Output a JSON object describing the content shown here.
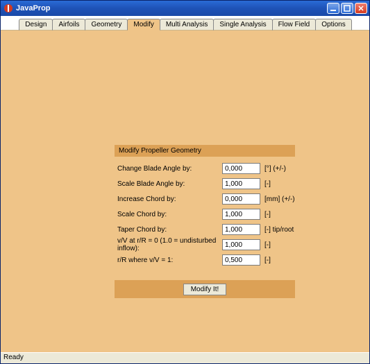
{
  "window": {
    "title": "JavaProp"
  },
  "tabs": {
    "items": [
      {
        "label": "Design"
      },
      {
        "label": "Airfoils"
      },
      {
        "label": "Geometry"
      },
      {
        "label": "Modify"
      },
      {
        "label": "Multi Analysis"
      },
      {
        "label": "Single Analysis"
      },
      {
        "label": "Flow Field"
      },
      {
        "label": "Options"
      }
    ],
    "active_index": 3
  },
  "panel": {
    "header": "Modify Propeller Geometry",
    "rows": [
      {
        "label": "Change Blade Angle by:",
        "value": "0,000",
        "unit": "[°]   (+/-)"
      },
      {
        "label": "Scale Blade Angle by:",
        "value": "1,000",
        "unit": "[-]"
      },
      {
        "label": "Increase Chord by:",
        "value": "0,000",
        "unit": "[mm]   (+/-)"
      },
      {
        "label": "Scale Chord by:",
        "value": "1,000",
        "unit": "[-]"
      },
      {
        "label": "Taper Chord by:",
        "value": "1,000",
        "unit": "[-]   tip/root"
      },
      {
        "label": "v/V at r/R = 0 (1.0 = undisturbed inflow):",
        "value": "1,000",
        "unit": "[-]"
      },
      {
        "label": "r/R where v/V = 1:",
        "value": "0,500",
        "unit": "[-]"
      }
    ],
    "button": "Modify It!"
  },
  "status": {
    "text": "Ready"
  }
}
